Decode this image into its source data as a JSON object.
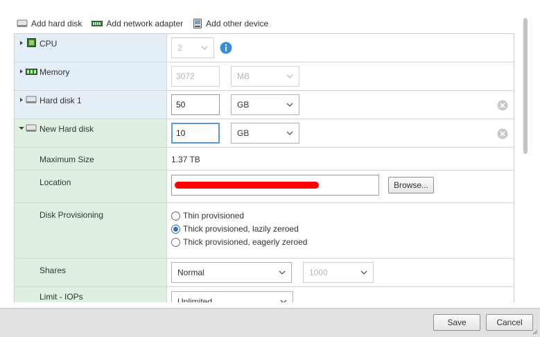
{
  "toolbar": {
    "add_hard_disk": "Add hard disk",
    "add_network_adapter": "Add network adapter",
    "add_other_device": "Add other device"
  },
  "rows": {
    "cpu": {
      "label": "CPU",
      "value": "2"
    },
    "memory": {
      "label": "Memory",
      "value": "3072",
      "unit": "MB"
    },
    "hard_disk_1": {
      "label": "Hard disk 1",
      "value": "50",
      "unit": "GB"
    },
    "new_hard_disk": {
      "label": "New Hard disk",
      "value": "10",
      "unit": "GB"
    },
    "maximum_size": {
      "label": "Maximum Size",
      "value": "1.37 TB"
    },
    "location": {
      "label": "Location",
      "browse": "Browse..."
    },
    "disk_provisioning": {
      "label": "Disk Provisioning",
      "options": [
        "Thin provisioned",
        "Thick provisioned, lazily zeroed",
        "Thick provisioned, eagerly zeroed"
      ],
      "selected": "Thick provisioned, lazily zeroed"
    },
    "shares": {
      "label": "Shares",
      "value": "Normal",
      "amount": "1000"
    },
    "limit_iops": {
      "label": "Limit - IOPs",
      "value": "Unlimited"
    }
  },
  "footer": {
    "save": "Save",
    "cancel": "Cancel"
  },
  "colors": {
    "accent": "#2f6fc0",
    "focus_border": "#5b9bd5",
    "hardware_label_bg": "#e3eef7",
    "new_disk_label_bg": "#dff0e0",
    "redaction": "#ff0000",
    "info_blue": "#3a8ed8"
  },
  "icons": [
    "hard-disk-icon",
    "network-adapter-icon",
    "device-icon",
    "cpu-icon",
    "memory-icon",
    "info-icon",
    "remove-icon",
    "chevron-down-icon",
    "expander-right-icon",
    "expander-down-icon"
  ]
}
